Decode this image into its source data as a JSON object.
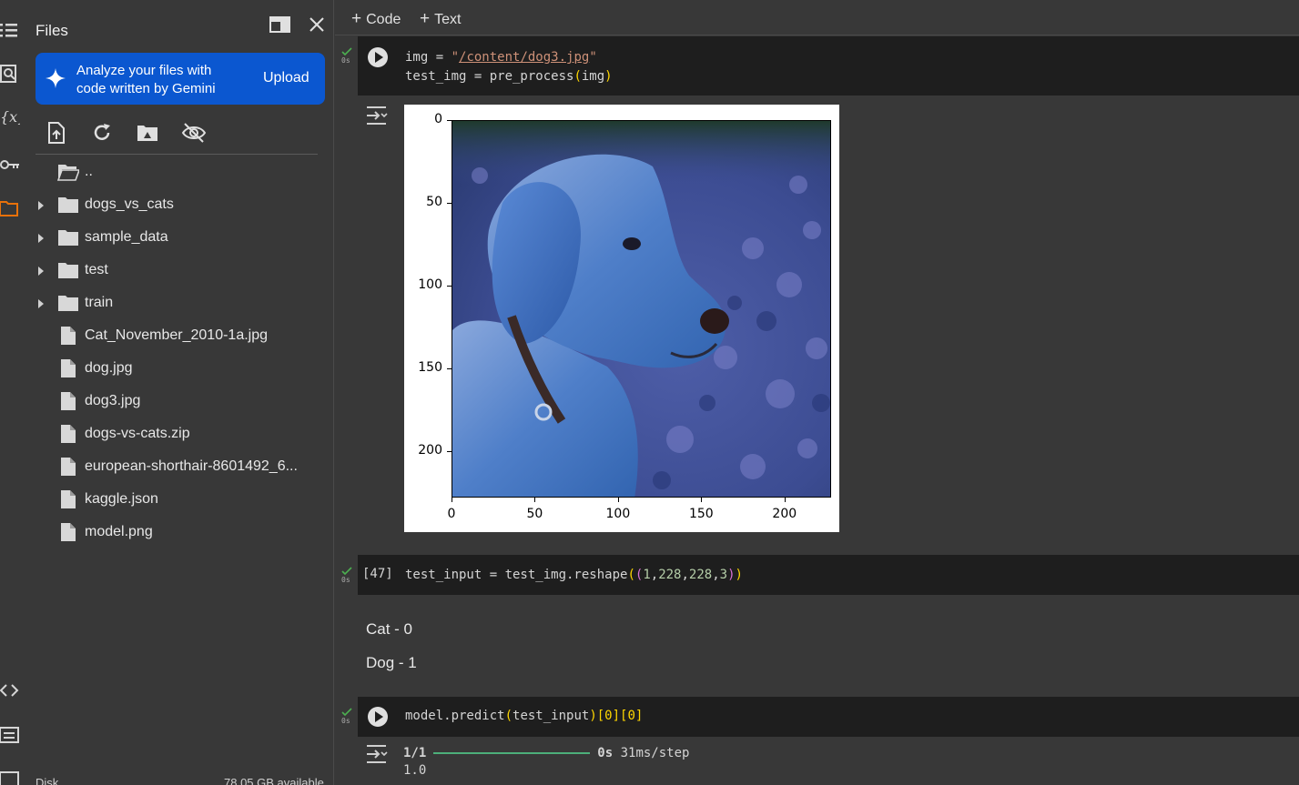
{
  "files_panel": {
    "title": "Files",
    "gemini_banner": {
      "line1": "Analyze your files with",
      "line2": "code written by Gemini",
      "action": "Upload"
    },
    "tree": [
      {
        "label": "..",
        "kind": "folder-open"
      },
      {
        "label": "dogs_vs_cats",
        "kind": "folder"
      },
      {
        "label": "sample_data",
        "kind": "folder"
      },
      {
        "label": "test",
        "kind": "folder"
      },
      {
        "label": "train",
        "kind": "folder"
      },
      {
        "label": "Cat_November_2010-1a.jpg",
        "kind": "file"
      },
      {
        "label": "dog.jpg",
        "kind": "file"
      },
      {
        "label": "dog3.jpg",
        "kind": "file"
      },
      {
        "label": "dogs-vs-cats.zip",
        "kind": "file"
      },
      {
        "label": "european-shorthair-8601492_6...",
        "kind": "file"
      },
      {
        "label": "kaggle.json",
        "kind": "file"
      },
      {
        "label": "model.png",
        "kind": "file"
      }
    ],
    "disk_label": "Disk",
    "disk_available": "78.05 GB available"
  },
  "toolbar": {
    "code_label": "Code",
    "text_label": "Text",
    "plus": "+"
  },
  "cells": {
    "cell1": {
      "time": "0s",
      "line1_a": "img = ",
      "line1_q1": "\"",
      "line1_link": "/content/dog3.jpg",
      "line1_q2": "\"",
      "line2_a": "test_img = pre_process",
      "line2_p1": "(",
      "line2_arg": "img",
      "line2_p2": ")"
    },
    "cell2": {
      "time": "0s",
      "count": "[47]",
      "code_a": "test_input = test_img.reshape",
      "p1": "(",
      "p2": "(",
      "n1": "1",
      "c1": ",",
      "n2": "228",
      "c2": ",",
      "n3": "228",
      "c3": ",",
      "n4": "3",
      "p3": ")",
      "p4": ")"
    },
    "markdown": {
      "line1": "Cat - 0",
      "line2": "Dog - 1"
    },
    "cell3": {
      "time": "0s",
      "code_a": "model.predict",
      "p1": "(",
      "arg": "test_input",
      "p2": ")",
      "idx": "[0][0]",
      "out_step": "1/1",
      "out_time": "0s",
      "out_rate": "31ms/step",
      "out_value": "1.0"
    }
  },
  "plot": {
    "y_ticks": [
      "0",
      "50",
      "100",
      "150",
      "200"
    ],
    "x_ticks": [
      "0",
      "50",
      "100",
      "150",
      "200"
    ]
  },
  "colors": {
    "accent_blue": "#0b57d0",
    "check_green": "#4caf50",
    "folder_orange": "#e8710a"
  }
}
